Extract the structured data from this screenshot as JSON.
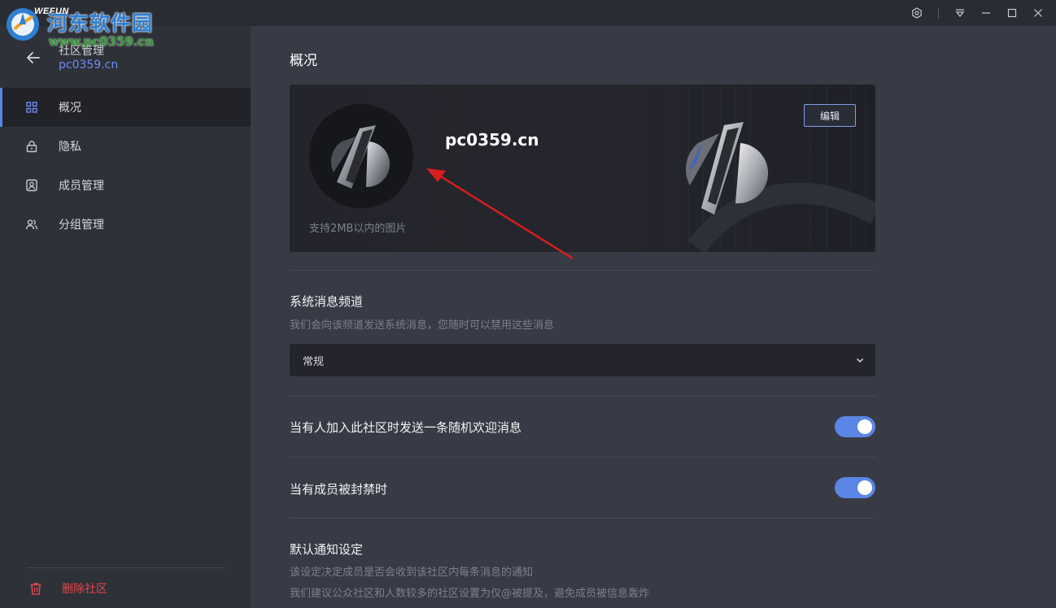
{
  "watermark": {
    "app_name": "WEFUN",
    "site_name": "河东软件园",
    "site_url": "www.pc0359.cn"
  },
  "window_controls": [
    "settings-icon",
    "dropdown-icon",
    "minimize-icon",
    "maximize-icon",
    "close-icon"
  ],
  "sidebar": {
    "title": "社区管理",
    "subtitle": "pc0359.cn",
    "items": [
      {
        "label": "概况",
        "icon": "grid-icon",
        "active": true
      },
      {
        "label": "隐私",
        "icon": "lock-icon",
        "active": false
      },
      {
        "label": "成员管理",
        "icon": "member-icon",
        "active": false
      },
      {
        "label": "分组管理",
        "icon": "group-icon",
        "active": false
      }
    ],
    "delete_label": "删除社区"
  },
  "main": {
    "title": "概况",
    "banner": {
      "name": "pc0359.cn",
      "hint": "支持2MB以内的图片",
      "edit_label": "编辑"
    },
    "system_channel": {
      "title": "系统消息频道",
      "desc": "我们会向该频道发送系统消息，您随时可以禁用这些消息",
      "selected": "常规"
    },
    "toggles": [
      {
        "label": "当有人加入此社区时发送一条随机欢迎消息",
        "on": true
      },
      {
        "label": "当有成员被封禁时",
        "on": true
      }
    ],
    "notification": {
      "title": "默认通知设定",
      "desc1": "该设定决定成员是否会收到该社区内每条消息的通知",
      "desc2": "我们建议公众社区和人数较多的社区设置为仅@被提及，避免成员被信息轰炸"
    }
  },
  "colors": {
    "accent": "#5b86e5",
    "danger": "#e0474a",
    "annotation_arrow": "#d81e1e"
  }
}
